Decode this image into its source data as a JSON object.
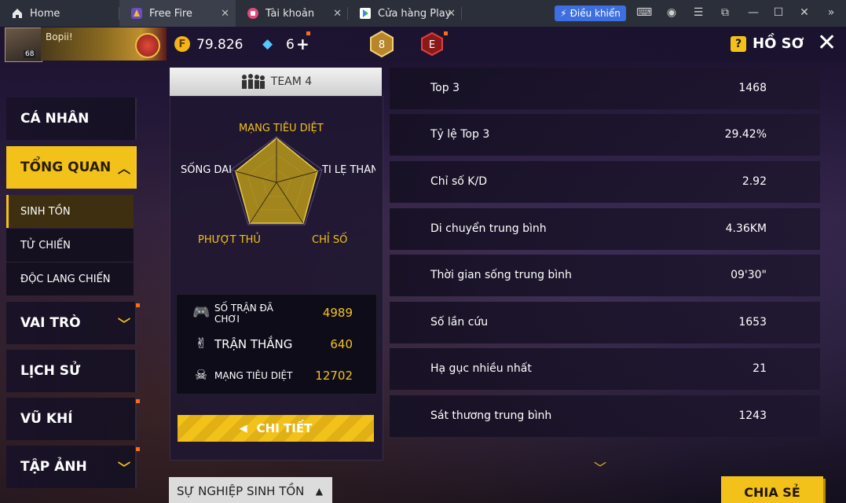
{
  "browser": {
    "tabs": [
      {
        "label": "Home",
        "icon": "home-icon"
      },
      {
        "label": "Free Fire",
        "icon": "free-fire-icon"
      },
      {
        "label": "Tài khoản",
        "icon": "account-icon"
      },
      {
        "label": "Cửa hàng Play",
        "icon": "play-store-icon"
      }
    ],
    "control_button": "Điều khiển",
    "window_controls": [
      "gamepad-icon",
      "user-icon",
      "menu-icon",
      "restore-icon",
      "minimize-icon",
      "maximize-icon",
      "close-icon",
      "expand-icon"
    ]
  },
  "header": {
    "player_name": "Bopii!",
    "level": "68",
    "coins": "79.826",
    "diamonds": "6",
    "rank_badge": "8",
    "elite_badge": "E",
    "title": "HỒ SƠ"
  },
  "nav": {
    "items": [
      {
        "label": "CÁ NHÂN"
      },
      {
        "label": "TỔNG QUAN",
        "active": true
      },
      {
        "label": "VAI TRÒ"
      },
      {
        "label": "LỊCH SỬ"
      },
      {
        "label": "VŨ KHÍ"
      },
      {
        "label": "TẬP ẢNH"
      }
    ],
    "sub_items": [
      {
        "label": "SINH TỒN",
        "active": true
      },
      {
        "label": "TỬ CHIẾN"
      },
      {
        "label": "ĐỘC LANG CHIẾN"
      }
    ]
  },
  "center": {
    "team_label": "TEAM 4",
    "radar": {
      "top": "MẠNG TIÊU DIỆT",
      "right": "TỈ LỆ THẮNG",
      "bottom_right": "CHỈ SỐ",
      "bottom_left": "PHƯỢT THỦ",
      "left": "SỐNG DAI"
    },
    "stats": [
      {
        "label": "SỐ TRẬN ĐÃ CHƠI",
        "value": "4989",
        "icon": "gamepad-icon"
      },
      {
        "label": "TRẬN THẮNG",
        "value": "640",
        "icon": "victory-hand-icon"
      },
      {
        "label": "MẠNG TIÊU DIỆT",
        "value": "12702",
        "icon": "skull-icon"
      }
    ],
    "detail_button": "CHI TIẾT"
  },
  "right_stats": [
    {
      "label": "Top 3",
      "value": "1468"
    },
    {
      "label": "Tỷ lệ Top 3",
      "value": "29.42%"
    },
    {
      "label": "Chỉ số K/D",
      "value": "2.92"
    },
    {
      "label": "Di chuyển trung bình",
      "value": "4.36KM"
    },
    {
      "label": "Thời gian sống trung bình",
      "value": "09'30\""
    },
    {
      "label": "Số lần cứu",
      "value": "1653"
    },
    {
      "label": "Hạ gục nhiều nhất",
      "value": "21"
    },
    {
      "label": "Sát thương trung bình",
      "value": "1243"
    }
  ],
  "bottom": {
    "career_dropdown": "SỰ NGHIỆP SINH TỒN",
    "share_button": "CHIA SẺ"
  },
  "colors": {
    "accent": "#f2c21b",
    "panel": "#1e1630",
    "browser_bar": "#2b2f3a",
    "control_blue": "#3d6fe0"
  }
}
